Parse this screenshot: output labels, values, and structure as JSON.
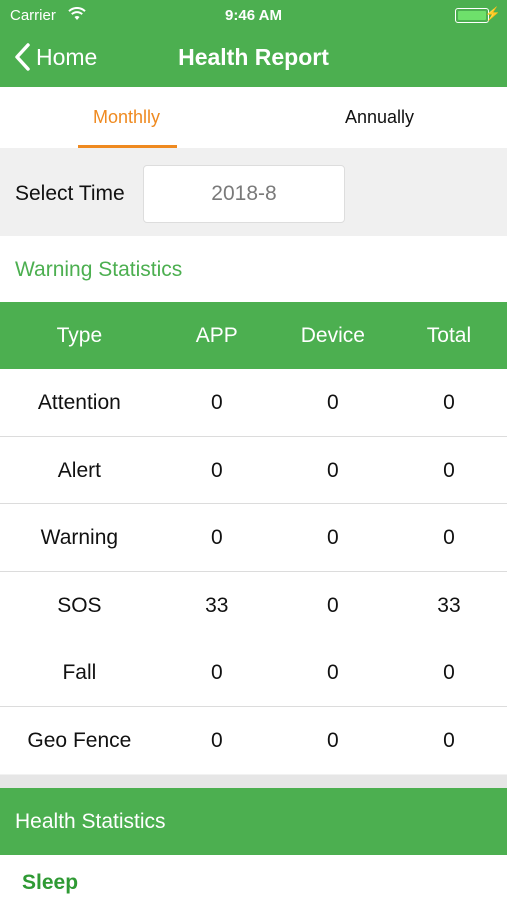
{
  "status_bar": {
    "carrier": "Carrier",
    "time": "9:46 AM",
    "battery_color": "#6ee06b"
  },
  "nav": {
    "back_label": "Home",
    "title": "Health Report"
  },
  "tabs": [
    {
      "label": "Monthlly",
      "active": true
    },
    {
      "label": "Annually",
      "active": false
    }
  ],
  "select_time": {
    "label": "Select Time",
    "value": "2018-8"
  },
  "warning_statistics": {
    "title": "Warning Statistics",
    "columns": [
      "Type",
      "APP",
      "Device",
      "Total"
    ],
    "rows": [
      [
        "Attention",
        "0",
        "0",
        "0"
      ],
      [
        "Alert",
        "0",
        "0",
        "0"
      ],
      [
        "Warning",
        "0",
        "0",
        "0"
      ],
      [
        "SOS",
        "33",
        "0",
        "33"
      ],
      [
        "Fall",
        "0",
        "0",
        "0"
      ],
      [
        "Geo Fence",
        "0",
        "0",
        "0"
      ]
    ]
  },
  "health_statistics": {
    "title": "Health Statistics",
    "first_item": "Sleep"
  },
  "colors": {
    "primary_green": "#4caf50",
    "accent_orange": "#ef8a20"
  }
}
